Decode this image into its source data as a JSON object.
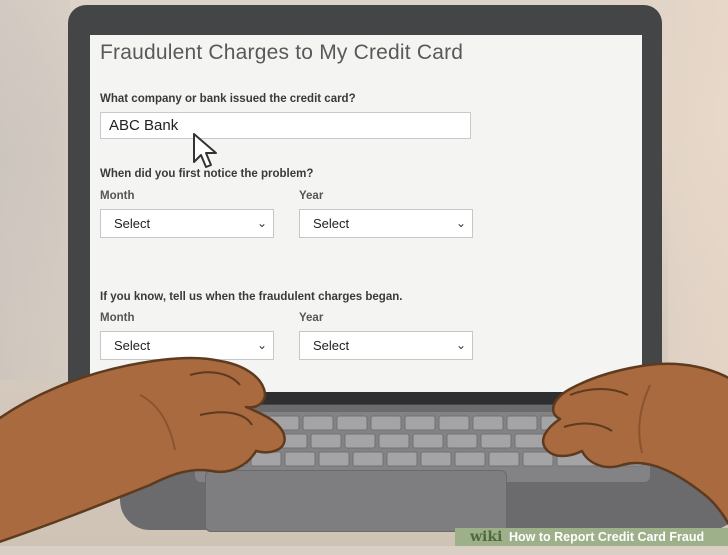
{
  "page": {
    "title": "Fraudulent Charges to My Credit Card"
  },
  "form": {
    "question1": "What company or bank issued the credit card?",
    "bank_value": "ABC Bank",
    "question2": "When did you first notice the problem?",
    "month_label_1": "Month",
    "year_label_1": "Year",
    "month_select_1": "Select",
    "year_select_1": "Select",
    "question3": "If you know, tell us when the fraudulent charges began.",
    "month_label_2": "Month",
    "year_label_2": "Year",
    "month_select_2": "Select",
    "year_select_2": "Select"
  },
  "icons": {
    "chevron": "chevron-down-icon",
    "cursor": "mouse-pointer-icon"
  },
  "footer": {
    "brand": "wiki",
    "caption": "How to Report Credit Card Fraud"
  },
  "colors": {
    "laptop_bezel": "#444547",
    "screen_bg": "#f4f4f3",
    "footer_bg": "#9db08a"
  }
}
